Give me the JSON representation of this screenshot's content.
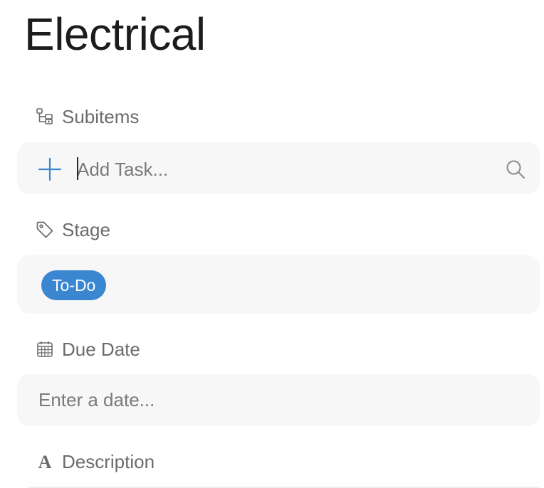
{
  "title": "Electrical",
  "subitems": {
    "label": "Subitems",
    "icon": "subitems-tree-icon",
    "add_placeholder": "Add Task...",
    "add_icon": "plus-icon",
    "search_icon": "search-icon"
  },
  "stage": {
    "label": "Stage",
    "icon": "tag-icon",
    "value": "To-Do",
    "chip_color": "#3a86d0"
  },
  "due_date": {
    "label": "Due Date",
    "icon": "calendar-icon",
    "placeholder": "Enter a date..."
  },
  "description": {
    "label": "Description",
    "icon": "text-format-icon"
  },
  "colors": {
    "accent": "#3a86d0",
    "field_background": "#f7f7f7",
    "label_text": "#6b6b6f"
  }
}
